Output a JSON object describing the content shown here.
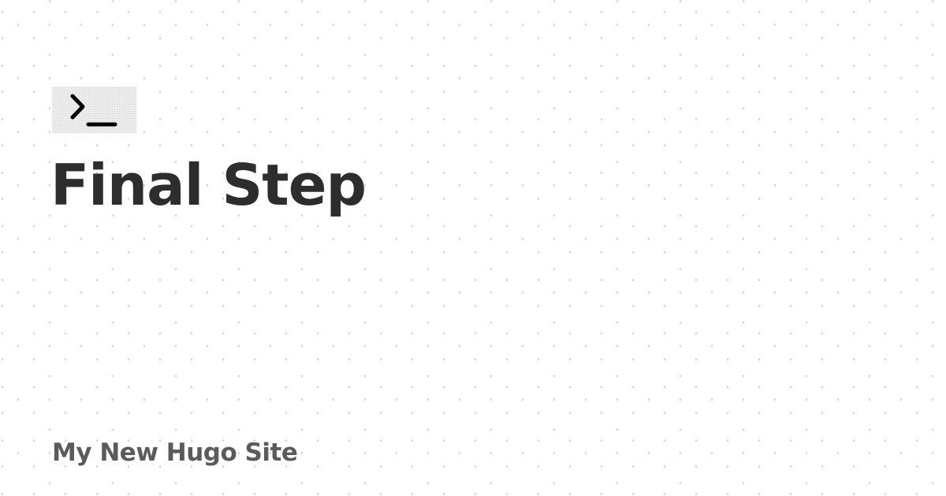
{
  "page": {
    "title": "Final Step",
    "site_name": "My New Hugo Site"
  },
  "logo": {
    "icon": "terminal-prompt-icon"
  },
  "colors": {
    "background": "#ffffff",
    "title": "#2d2d2d",
    "site_name": "#5b5b5b",
    "pattern_dot": "#cccccc",
    "logo_tile": "#ececec",
    "logo_glyph": "#000000"
  }
}
